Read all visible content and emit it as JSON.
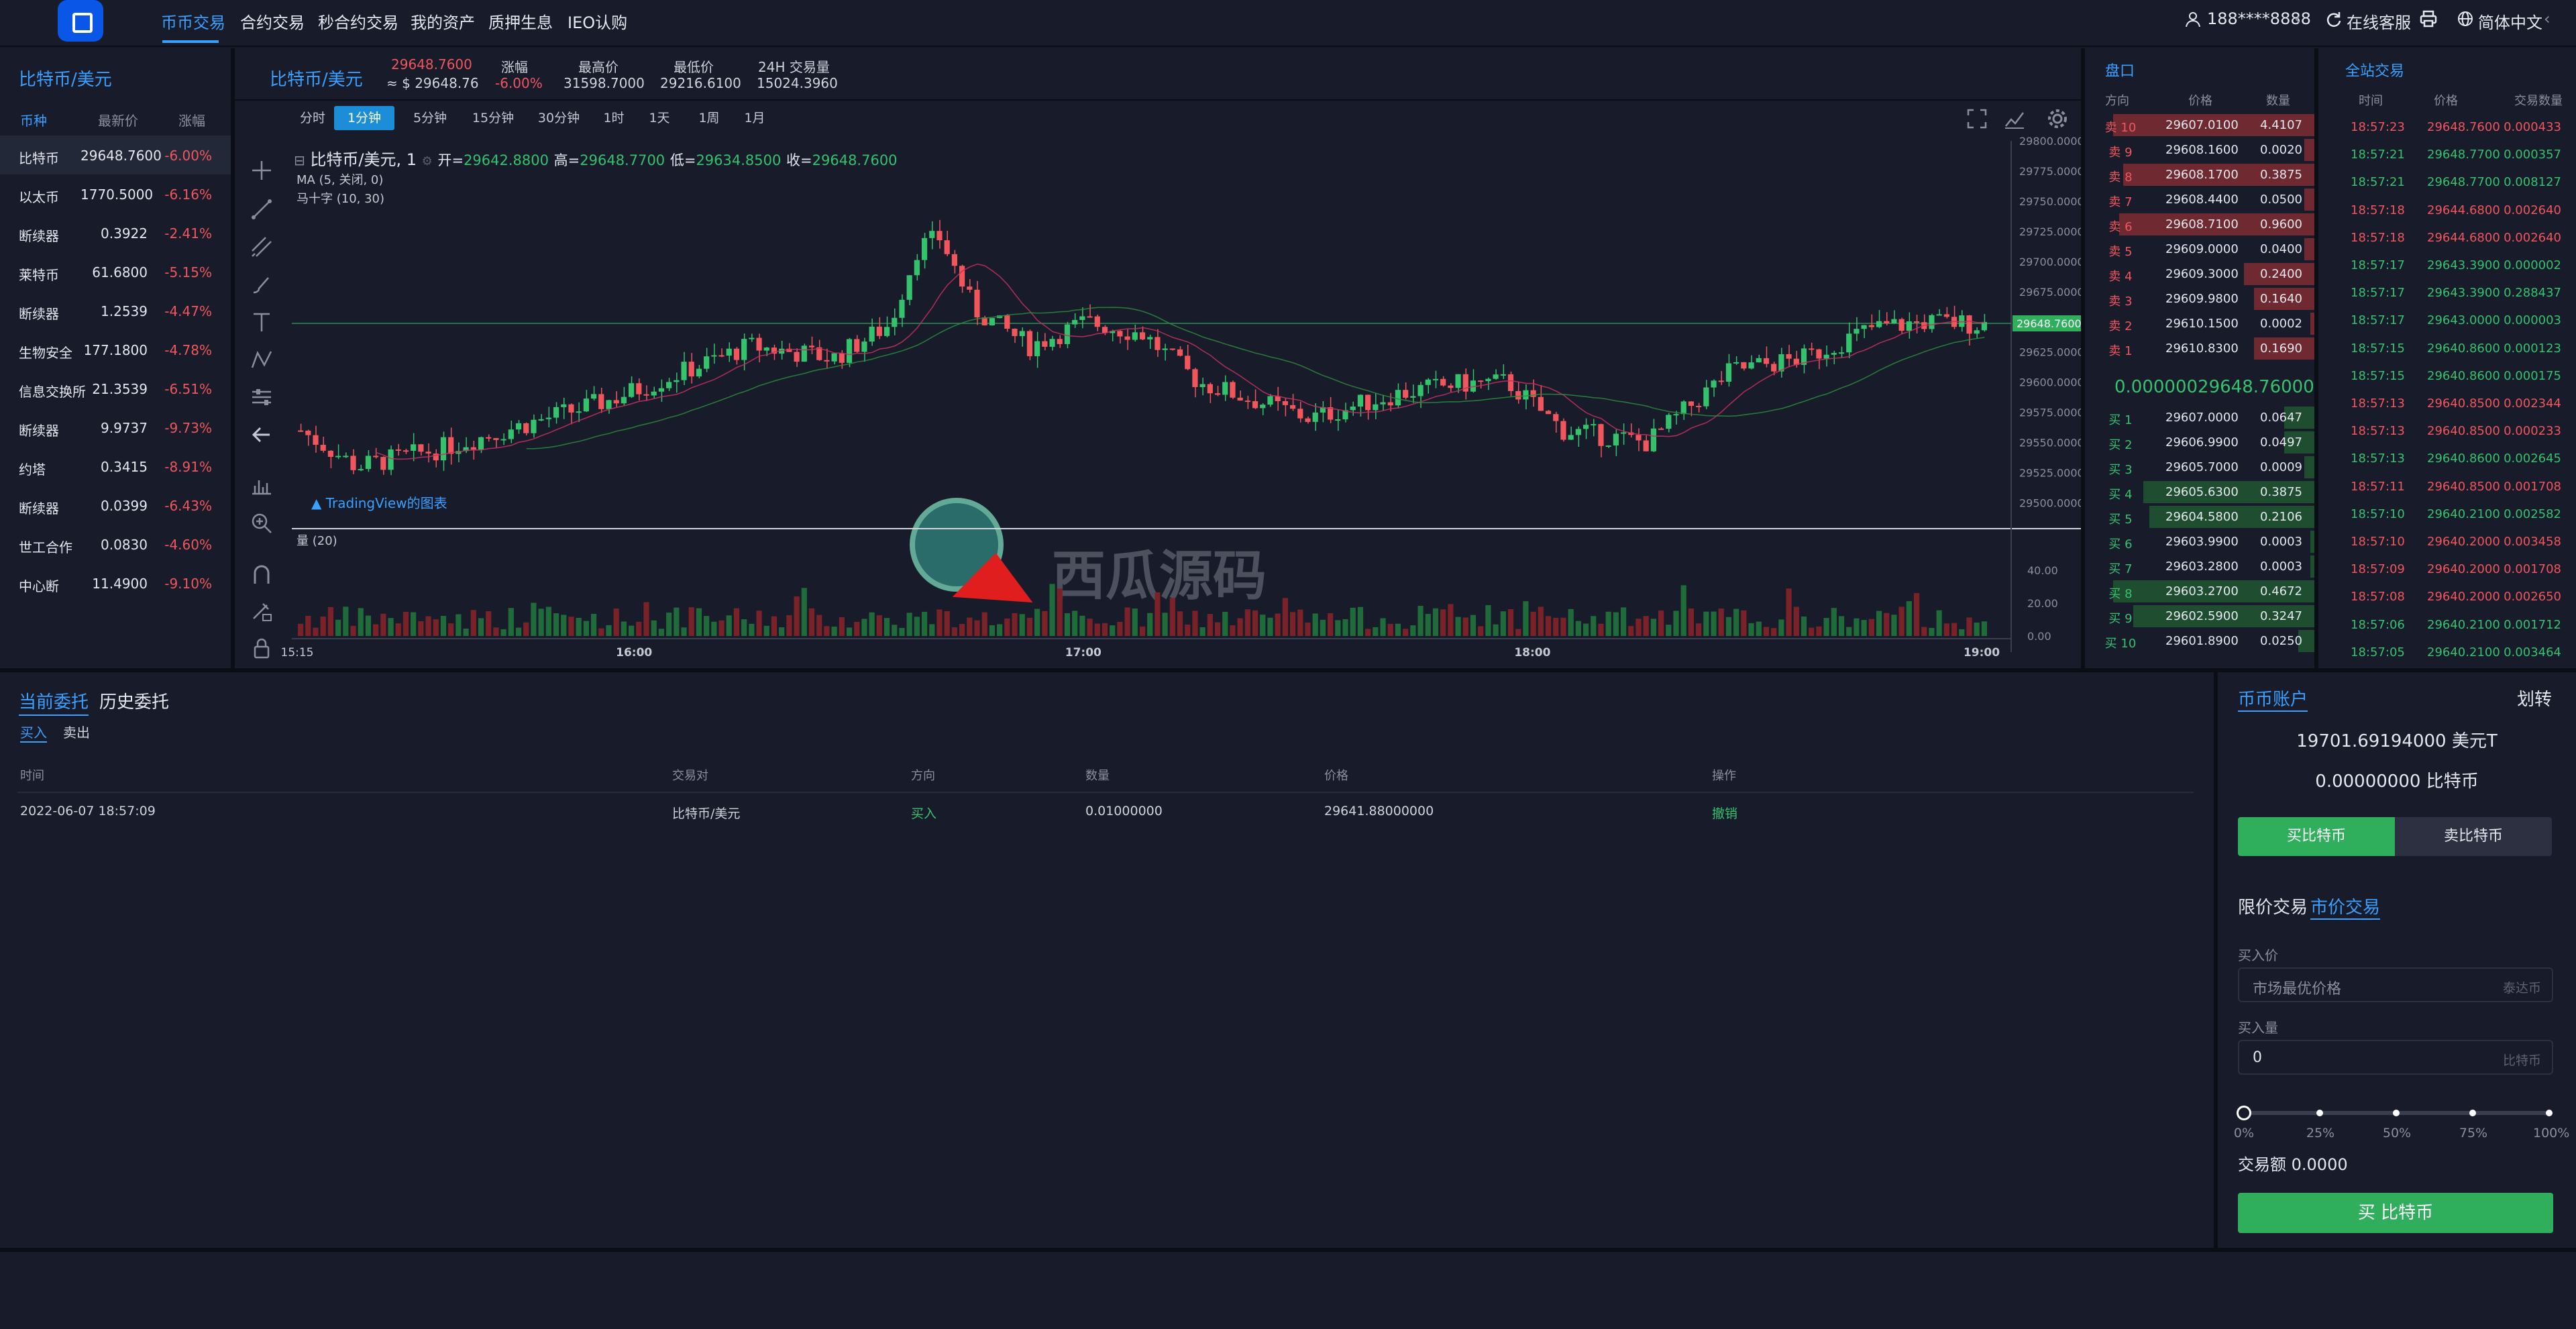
{
  "nav": {
    "items": [
      "币币交易",
      "合约交易",
      "秒合约交易",
      "我的资产",
      "质押生息",
      "IEO认购"
    ],
    "user": "188****8888",
    "service": "在线客服",
    "lang": "简体中文"
  },
  "market": {
    "title": "比特币/美元",
    "headers": [
      "币种",
      "最新价",
      "涨幅"
    ],
    "rows": [
      {
        "name": "比特币",
        "price": "29648.7600",
        "change": "-6.00%"
      },
      {
        "name": "以太币",
        "price": "1770.5000",
        "change": "-6.16%"
      },
      {
        "name": "断续器",
        "price": "0.3922",
        "change": "-2.41%"
      },
      {
        "name": "莱特币",
        "price": "61.6800",
        "change": "-5.15%"
      },
      {
        "name": "断续器",
        "price": "1.2539",
        "change": "-4.47%"
      },
      {
        "name": "生物安全",
        "price": "177.1800",
        "change": "-4.78%"
      },
      {
        "name": "信息交换所",
        "price": "21.3539",
        "change": "-6.51%"
      },
      {
        "name": "断续器",
        "price": "9.9737",
        "change": "-9.73%"
      },
      {
        "name": "约塔",
        "price": "0.3415",
        "change": "-8.91%"
      },
      {
        "name": "断续器",
        "price": "0.0399",
        "change": "-6.43%"
      },
      {
        "name": "世工合作",
        "price": "0.0830",
        "change": "-4.60%"
      },
      {
        "name": "中心断",
        "price": "11.4900",
        "change": "-9.10%"
      }
    ]
  },
  "ticker": {
    "pair": "比特币/美元",
    "price": "29648.7600",
    "usd": "≈ $ 29648.76",
    "change_label": "涨幅",
    "change": "-6.00%",
    "high_label": "最高价",
    "high": "31598.7000",
    "low_label": "最低价",
    "low": "29216.6100",
    "vol_label": "24H 交易量",
    "vol": "15024.3960"
  },
  "chart": {
    "intervals": [
      "分时",
      "1分钟",
      "5分钟",
      "15分钟",
      "30分钟",
      "1时",
      "1天",
      "1周",
      "1月"
    ],
    "active_interval": "1分钟",
    "legend_pair": "比特币/美元, 1",
    "open_label": "开=",
    "open": "29642.8800",
    "high_label": "高=",
    "high": "29648.7700",
    "low_label": "低=",
    "low": "29634.8500",
    "close_label": "收=",
    "close": "29648.7600",
    "ma": "MA (5, 关闭, 0)",
    "cross": "马十字 (10, 30)",
    "vol_label": "量 (20)",
    "watermark": "TradingView的图表",
    "brand": "西瓜源码",
    "price_ticks": [
      "29800.0000",
      "29775.0000",
      "29750.0000",
      "29725.0000",
      "29700.0000",
      "29675.0000",
      "29650.0000",
      "29625.0000",
      "29600.0000",
      "29575.0000",
      "29550.0000",
      "29525.0000",
      "29500.0000"
    ],
    "current_price": "29648.7600",
    "vol_ticks": [
      "40.00",
      "20.00",
      "0.00"
    ],
    "time_ticks": [
      "15:15",
      "16:00",
      "17:00",
      "18:00",
      "19:00"
    ]
  },
  "chart_data": {
    "type": "candlestick",
    "title": "比特币/美元, 1",
    "xlabel": "",
    "ylabel": "",
    "x_range": [
      "15:15",
      "19:00"
    ],
    "ylim": [
      29487.5,
      29800
    ],
    "volume_ylim": [
      0,
      40
    ],
    "last_close": 29648.76
  },
  "orderbook": {
    "title": "盘口",
    "headers": [
      "方向",
      "价格",
      "数量"
    ],
    "asks": [
      {
        "label": "卖 10",
        "price": "29607.0100",
        "qty": "4.4107",
        "depth": 1.0
      },
      {
        "label": "卖 9",
        "price": "29608.1600",
        "qty": "0.0020",
        "depth": 0.05
      },
      {
        "label": "卖 8",
        "price": "29608.1700",
        "qty": "0.3875",
        "depth": 0.95
      },
      {
        "label": "卖 7",
        "price": "29608.4400",
        "qty": "0.0500",
        "depth": 0.05
      },
      {
        "label": "卖 6",
        "price": "29608.7100",
        "qty": "0.9600",
        "depth": 0.97
      },
      {
        "label": "卖 5",
        "price": "29609.0000",
        "qty": "0.0400",
        "depth": 0.05
      },
      {
        "label": "卖 4",
        "price": "29609.3000",
        "qty": "0.2400",
        "depth": 0.35
      },
      {
        "label": "卖 3",
        "price": "29609.9800",
        "qty": "0.1640",
        "depth": 0.3
      },
      {
        "label": "卖 2",
        "price": "29610.1500",
        "qty": "0.0002",
        "depth": 0.02
      },
      {
        "label": "卖 1",
        "price": "29610.8300",
        "qty": "0.1690",
        "depth": 0.3
      }
    ],
    "mid": "0.00000029648.760000",
    "bids": [
      {
        "label": "买 1",
        "price": "29607.0000",
        "qty": "0.0647",
        "depth": 0.15
      },
      {
        "label": "买 2",
        "price": "29606.9900",
        "qty": "0.0497",
        "depth": 0.15
      },
      {
        "label": "买 3",
        "price": "29605.7000",
        "qty": "0.0009",
        "depth": 0.05
      },
      {
        "label": "买 4",
        "price": "29605.6300",
        "qty": "0.3875",
        "depth": 0.85
      },
      {
        "label": "买 5",
        "price": "29604.5800",
        "qty": "0.2106",
        "depth": 0.82
      },
      {
        "label": "买 6",
        "price": "29603.9900",
        "qty": "0.0003",
        "depth": 0.02
      },
      {
        "label": "买 7",
        "price": "29603.2800",
        "qty": "0.0003",
        "depth": 0.02
      },
      {
        "label": "买 8",
        "price": "29603.2700",
        "qty": "0.4672",
        "depth": 1.0
      },
      {
        "label": "买 9",
        "price": "29602.5900",
        "qty": "0.3247",
        "depth": 0.9
      },
      {
        "label": "买 10",
        "price": "29601.8900",
        "qty": "0.0250",
        "depth": 0.08
      }
    ]
  },
  "trades": {
    "title": "全站交易",
    "headers": [
      "时间",
      "价格",
      "交易数量"
    ],
    "rows": [
      {
        "t": "18:57:23",
        "p": "29648.7600",
        "q": "0.000433",
        "s": "sell"
      },
      {
        "t": "18:57:21",
        "p": "29648.7700",
        "q": "0.000357",
        "s": "buy"
      },
      {
        "t": "18:57:21",
        "p": "29648.7700",
        "q": "0.008127",
        "s": "buy"
      },
      {
        "t": "18:57:18",
        "p": "29644.6800",
        "q": "0.002640",
        "s": "sell"
      },
      {
        "t": "18:57:18",
        "p": "29644.6800",
        "q": "0.002640",
        "s": "sell"
      },
      {
        "t": "18:57:17",
        "p": "29643.3900",
        "q": "0.000002",
        "s": "buy"
      },
      {
        "t": "18:57:17",
        "p": "29643.3900",
        "q": "0.288437",
        "s": "buy"
      },
      {
        "t": "18:57:17",
        "p": "29643.0000",
        "q": "0.000003",
        "s": "buy"
      },
      {
        "t": "18:57:15",
        "p": "29640.8600",
        "q": "0.000123",
        "s": "buy"
      },
      {
        "t": "18:57:15",
        "p": "29640.8600",
        "q": "0.000175",
        "s": "buy"
      },
      {
        "t": "18:57:13",
        "p": "29640.8500",
        "q": "0.002344",
        "s": "sell"
      },
      {
        "t": "18:57:13",
        "p": "29640.8500",
        "q": "0.000233",
        "s": "sell"
      },
      {
        "t": "18:57:13",
        "p": "29640.8600",
        "q": "0.002645",
        "s": "buy"
      },
      {
        "t": "18:57:11",
        "p": "29640.8500",
        "q": "0.001708",
        "s": "sell"
      },
      {
        "t": "18:57:10",
        "p": "29640.2100",
        "q": "0.002582",
        "s": "buy"
      },
      {
        "t": "18:57:10",
        "p": "29640.2000",
        "q": "0.003458",
        "s": "sell"
      },
      {
        "t": "18:57:09",
        "p": "29640.2000",
        "q": "0.001708",
        "s": "sell"
      },
      {
        "t": "18:57:08",
        "p": "29640.2000",
        "q": "0.002650",
        "s": "sell"
      },
      {
        "t": "18:57:06",
        "p": "29640.2100",
        "q": "0.001712",
        "s": "buy"
      },
      {
        "t": "18:57:05",
        "p": "29640.2100",
        "q": "0.003464",
        "s": "buy"
      }
    ]
  },
  "orders": {
    "tab_current": "当前委托",
    "tab_history": "历史委托",
    "sub_buy": "买入",
    "sub_sell": "卖出",
    "headers": [
      "时间",
      "交易对",
      "方向",
      "数量",
      "价格",
      "操作"
    ],
    "rows": [
      {
        "time": "2022-06-07 18:57:09",
        "pair": "比特币/美元",
        "dir": "买入",
        "qty": "0.01000000",
        "price": "29641.88000000",
        "action": "撤销"
      }
    ]
  },
  "account": {
    "title": "币币账户",
    "transfer": "划转",
    "balance1": "19701.69194000 美元T",
    "balance2": "0.00000000 比特币",
    "buy_tab": "买比特币",
    "sell_tab": "卖比特币",
    "limit": "限价交易",
    "market": "市价交易",
    "price_label": "买入价",
    "price_placeholder": "市场最优价格",
    "price_unit": "泰达币",
    "amount_label": "买入量",
    "amount_value": "0",
    "amount_unit": "比特币",
    "slider": [
      "0%",
      "25%",
      "50%",
      "75%",
      "100%"
    ],
    "slider_value": 0,
    "total": "交易额 0.0000",
    "buy_button": "买 比特币"
  },
  "colors": {
    "accent": "#3aa0ff",
    "up": "#35c26c",
    "down": "#f0565c",
    "bg": "#181b2a"
  }
}
